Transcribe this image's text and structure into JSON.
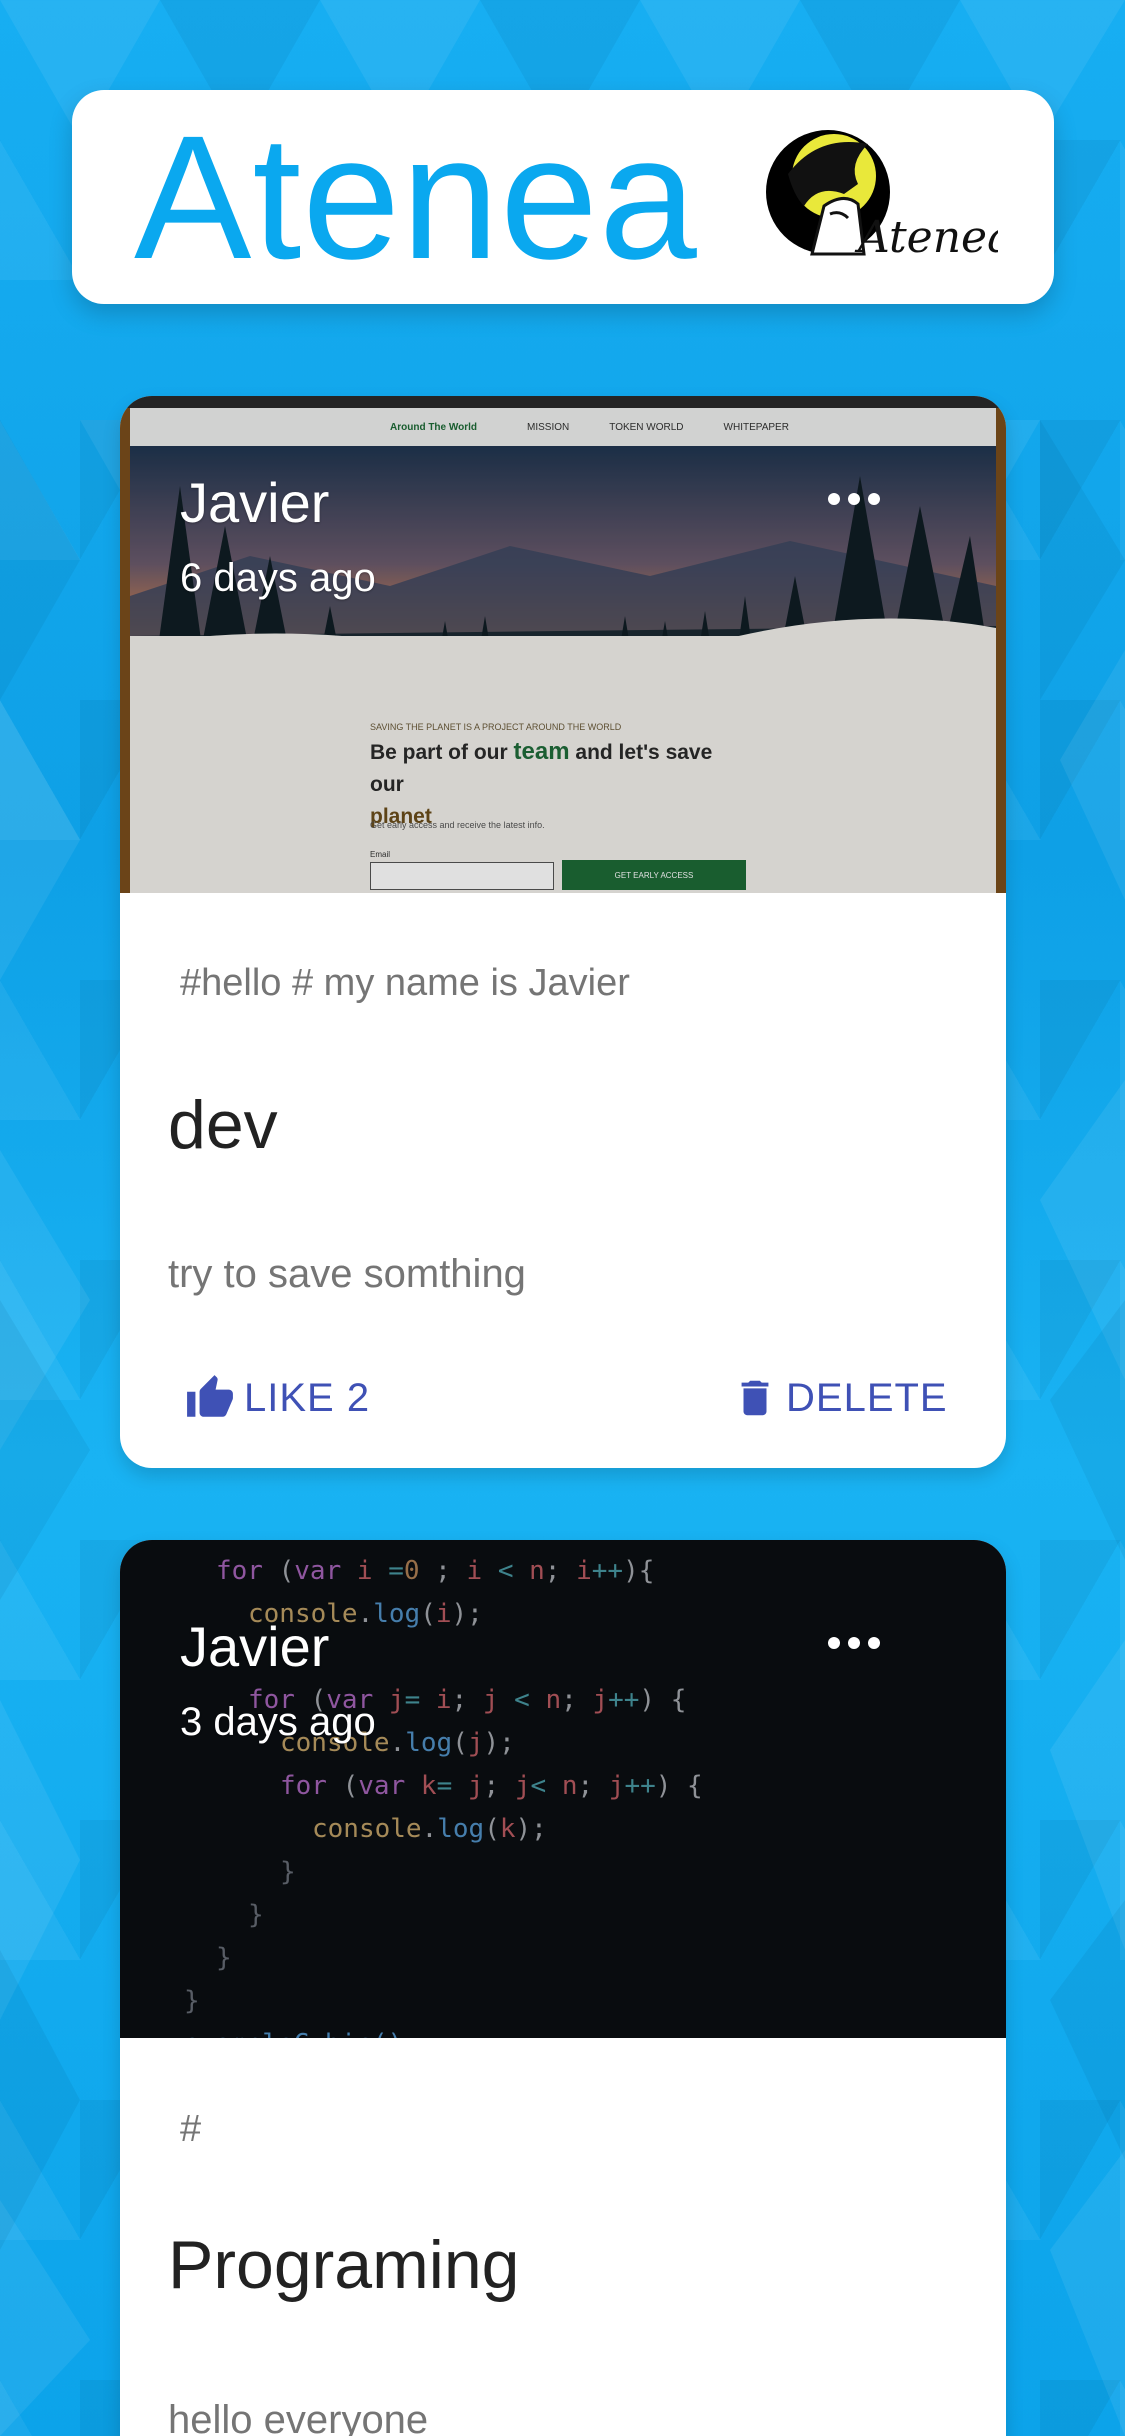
{
  "header": {
    "title": "Atenea",
    "logo_text": "Atenea"
  },
  "posts": [
    {
      "author": "Javier",
      "time": "6 days ago",
      "tags": "#hello # my name is Javier",
      "title": "dev",
      "body": "try to save somthing",
      "like_label": "LIKE 2",
      "delete_label": "DELETE",
      "image": {
        "site_name": "Around The World",
        "nav": [
          "MISSION",
          "TOKEN WORLD",
          "WHITEPAPER"
        ],
        "tagline": "SAVING THE PLANET IS A PROJECT AROUND THE WORLD",
        "heading_a": "Be part of our",
        "heading_team": "team",
        "heading_b": "and let's save our",
        "heading_planet": "planet",
        "sub": "Get early access and receive the latest info.",
        "email_label": "Email",
        "cta": "GET EARLY ACCESS"
      }
    },
    {
      "author": "Javier",
      "time": "3 days ago",
      "tags": "#",
      "title": "Programing",
      "body": "hello everyone"
    }
  ]
}
